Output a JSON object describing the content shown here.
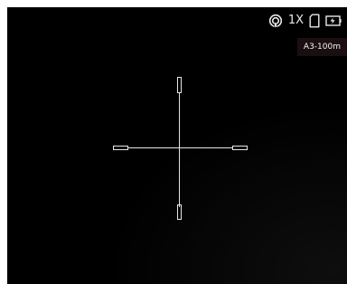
{
  "status": {
    "zoom": "1X",
    "icons": {
      "hotspot": "hotspot-icon",
      "storage": "sd-card-icon",
      "battery": "battery-icon"
    }
  },
  "profile": {
    "label": "A3-100m"
  },
  "reticle": {
    "type": "cross-with-posts",
    "color": "#e6e6e6"
  },
  "colors": {
    "background": "#000000",
    "text": "#e9e9e9",
    "badge_background": "#23121666"
  }
}
